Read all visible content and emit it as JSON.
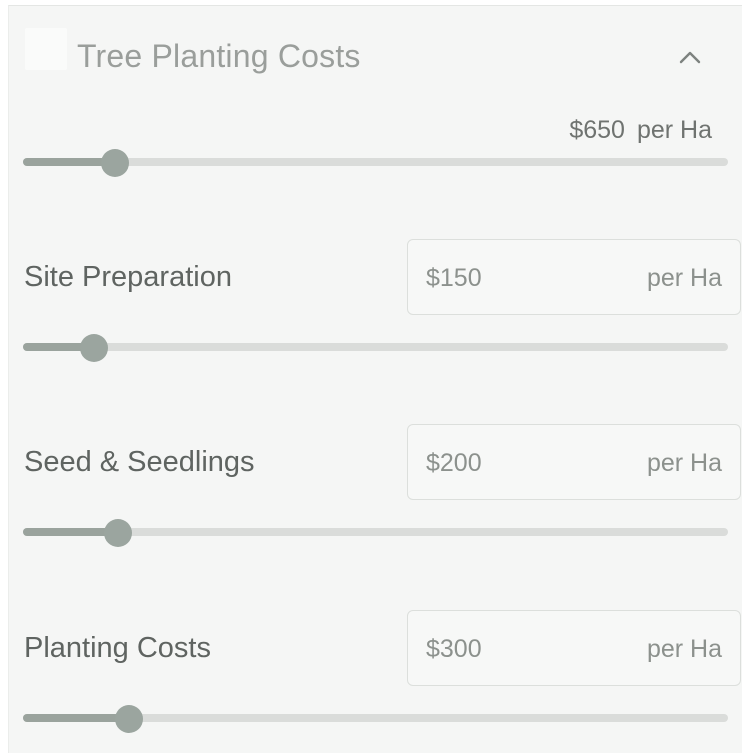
{
  "header": {
    "title": "Tree Planting Costs",
    "collapse_icon": "chevron-up-icon"
  },
  "total": {
    "amount": "$650",
    "unit": "per Ha",
    "slider_fraction": 0.13
  },
  "items": [
    {
      "label": "Site Preparation",
      "amount": "$150",
      "unit": "per Ha",
      "slider_fraction": 0.1
    },
    {
      "label": "Seed & Seedlings",
      "amount": "$200",
      "unit": "per Ha",
      "slider_fraction": 0.135
    },
    {
      "label": "Planting Costs",
      "amount": "$300",
      "unit": "per Ha",
      "slider_fraction": 0.15
    }
  ]
}
